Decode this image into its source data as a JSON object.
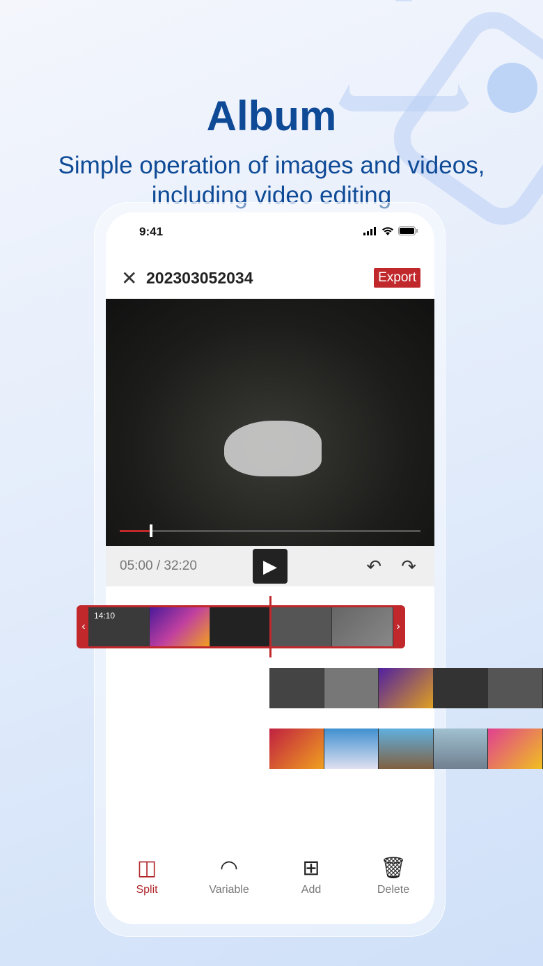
{
  "hero": {
    "title": "Album",
    "subtitle_line1": "Simple operation of images and videos,",
    "subtitle_line2": "including video editing"
  },
  "status_bar": {
    "time": "9:41"
  },
  "header": {
    "title": "202303052034",
    "export_label": "Export"
  },
  "player": {
    "timecode": "05:00 / 32:20",
    "progress_percent": 10
  },
  "timeline": {
    "clip_timestamp": "14:10"
  },
  "toolbar": [
    {
      "label": "Split",
      "icon": "split-icon",
      "active": true
    },
    {
      "label": "Variable",
      "icon": "speed-gauge-icon"
    },
    {
      "label": "Add",
      "icon": "add-square-icon"
    },
    {
      "label": "Delete",
      "icon": "trash-icon"
    }
  ],
  "colors": {
    "accent": "#c0282c",
    "brand": "#0e4a96"
  }
}
